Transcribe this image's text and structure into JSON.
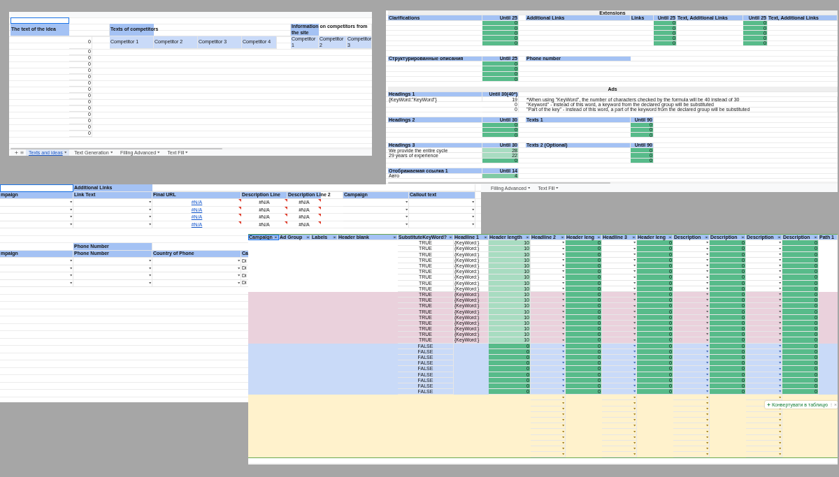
{
  "ideas_sheet": {
    "idea_header": "The text of the idea",
    "competitors_header": "Texts of competitors",
    "competitors": [
      "Competitor 1",
      "Competitor 2",
      "Competitor 3",
      "Competitor 4"
    ],
    "site_header": "Information on competitors from the site",
    "site_competitors": [
      "Competitor 1",
      "Competitor 2",
      "Competitor 3"
    ],
    "counts": [
      "0",
      "0",
      "0",
      "0",
      "0",
      "0",
      "0",
      "0",
      "0",
      "0",
      "0",
      "0",
      "0",
      "0",
      "0"
    ],
    "tabs": [
      {
        "label": "Texts and ideas",
        "selected": true
      },
      {
        "label": "Text Generation",
        "selected": false
      },
      {
        "label": "Filling Advanced",
        "selected": false
      },
      {
        "label": "Text Fill",
        "selected": false
      }
    ]
  },
  "extensions_sheet": {
    "rows": [
      {
        "kind": "band",
        "text": "Extensions"
      },
      {
        "kind": "cells",
        "cells": [
          {
            "text": "Clarifications",
            "kind": "head"
          },
          {
            "text": "Until 25",
            "kind": "head_num"
          },
          null,
          {
            "text": "Additional Links",
            "kind": "head"
          },
          {
            "text": "Links",
            "kind": "head"
          },
          {
            "text": "Until 25",
            "kind": "head_num"
          },
          {
            "text": "Text, Additional Links",
            "kind": "head"
          },
          {
            "text": "Until 25",
            "kind": "head_num"
          },
          {
            "text": "Text, Additional Links",
            "kind": "head"
          }
        ]
      },
      {
        "kind": "cells",
        "cells": [
          null,
          {
            "text": "0",
            "kind": "count"
          },
          null,
          null,
          null,
          {
            "text": "0",
            "kind": "count"
          },
          null,
          {
            "text": "0",
            "kind": "count"
          }
        ]
      },
      {
        "kind": "cells",
        "cells": [
          null,
          {
            "text": "0",
            "kind": "count"
          },
          null,
          null,
          null,
          {
            "text": "0",
            "kind": "count"
          },
          null,
          {
            "text": "0",
            "kind": "count"
          }
        ]
      },
      {
        "kind": "cells",
        "cells": [
          null,
          {
            "text": "0",
            "kind": "count"
          },
          null,
          null,
          null,
          {
            "text": "0",
            "kind": "count"
          },
          null,
          {
            "text": "0",
            "kind": "count"
          }
        ]
      },
      {
        "kind": "cells",
        "cells": [
          null,
          {
            "text": "0",
            "kind": "count"
          },
          null,
          null,
          null,
          {
            "text": "0",
            "kind": "count"
          },
          null,
          {
            "text": "0",
            "kind": "count"
          }
        ]
      },
      {
        "kind": "cells",
        "cells": [
          null,
          {
            "text": "0",
            "kind": "count"
          },
          null,
          null,
          null,
          {
            "text": "0",
            "kind": "count"
          },
          null,
          {
            "text": "0",
            "kind": "count"
          }
        ]
      },
      {
        "kind": "blank"
      },
      {
        "kind": "blank"
      },
      {
        "kind": "cells",
        "cells": [
          {
            "text": "Структурированные описания",
            "kind": "head"
          },
          {
            "text": "Until 25",
            "kind": "head_num"
          },
          null,
          {
            "text": "Phone number",
            "kind": "head"
          }
        ]
      },
      {
        "kind": "cells",
        "cells": [
          null,
          {
            "text": "0",
            "kind": "count"
          }
        ]
      },
      {
        "kind": "cells",
        "cells": [
          null,
          {
            "text": "0",
            "kind": "count"
          }
        ]
      },
      {
        "kind": "cells",
        "cells": [
          null,
          {
            "text": "0",
            "kind": "count"
          }
        ]
      },
      {
        "kind": "cells",
        "cells": [
          null,
          {
            "text": "0",
            "kind": "count"
          }
        ]
      },
      {
        "kind": "blank"
      },
      {
        "kind": "band",
        "text": "Ads"
      },
      {
        "kind": "cells",
        "cells": [
          {
            "text": "Headings 1",
            "kind": "head"
          },
          {
            "text": "Until 30(40*)",
            "kind": "head_num"
          }
        ]
      },
      {
        "kind": "cells",
        "cells": [
          {
            "text": "{KeyWord:\"KeyWord\"}",
            "kind": "text"
          },
          {
            "text": "19",
            "kind": "num"
          },
          null,
          {
            "text": "*When using \"KeyWord\", the number of characters checked by the formula will be 40 instead of 30",
            "kind": "note"
          }
        ]
      },
      {
        "kind": "cells",
        "cells": [
          null,
          {
            "text": "0",
            "kind": "num"
          },
          null,
          {
            "text": "\"Keyword\" - instead of this word, a keyword from the declared group will be substituted",
            "kind": "note"
          }
        ]
      },
      {
        "kind": "cells",
        "cells": [
          null,
          {
            "text": "0",
            "kind": "num"
          },
          null,
          {
            "text": "\"Part of the key\" - instead of this word, a part of the keyword from the declared group will be substituted",
            "kind": "note"
          }
        ]
      },
      {
        "kind": "blank"
      },
      {
        "kind": "cells",
        "cells": [
          {
            "text": "Headings 2",
            "kind": "head"
          },
          {
            "text": "Until 30",
            "kind": "head_num"
          },
          null,
          {
            "text": "Texts 1",
            "kind": "head"
          },
          {
            "text": "Until 90",
            "kind": "head_num"
          }
        ]
      },
      {
        "kind": "cells",
        "cells": [
          null,
          {
            "text": "0",
            "kind": "count"
          },
          null,
          null,
          {
            "text": "0",
            "kind": "count"
          }
        ]
      },
      {
        "kind": "cells",
        "cells": [
          null,
          {
            "text": "0",
            "kind": "count"
          },
          null,
          null,
          {
            "text": "0",
            "kind": "count"
          }
        ]
      },
      {
        "kind": "cells",
        "cells": [
          null,
          {
            "text": "0",
            "kind": "count"
          },
          null,
          null,
          {
            "text": "0",
            "kind": "count"
          }
        ]
      },
      {
        "kind": "blank"
      },
      {
        "kind": "cells",
        "cells": [
          {
            "text": "Headings 3",
            "kind": "head"
          },
          {
            "text": "Until 30",
            "kind": "head_num"
          },
          null,
          {
            "text": "Texts 2 (Optional)",
            "kind": "head"
          },
          {
            "text": "Until 90",
            "kind": "head_num"
          }
        ]
      },
      {
        "kind": "cells",
        "cells": [
          {
            "text": "We provide the entire cycle",
            "kind": "text"
          },
          {
            "text": "28",
            "kind": "count_light"
          },
          null,
          null,
          {
            "text": "0",
            "kind": "count"
          }
        ]
      },
      {
        "kind": "cells",
        "cells": [
          {
            "text": "29 years of experience",
            "kind": "text"
          },
          {
            "text": "22",
            "kind": "count_light"
          },
          null,
          null,
          {
            "text": "0",
            "kind": "count"
          }
        ]
      },
      {
        "kind": "cells",
        "cells": [
          null,
          {
            "text": "0",
            "kind": "count"
          },
          null,
          null,
          {
            "text": "0",
            "kind": "count"
          }
        ]
      },
      {
        "kind": "blank"
      },
      {
        "kind": "cells",
        "cells": [
          {
            "text": "Отображаемая ссылка 1",
            "kind": "head"
          },
          {
            "text": "Until 14",
            "kind": "head_num"
          }
        ]
      },
      {
        "kind": "cells",
        "cells": [
          {
            "text": "Авто",
            "kind": "text"
          },
          {
            "text": "4",
            "kind": "count_soft"
          }
        ]
      }
    ],
    "tabs": [
      {
        "label": "Filling Advanced",
        "selected": false
      },
      {
        "label": "Text Fill",
        "selected": false
      }
    ]
  },
  "links_sheet": {
    "rows": [
      {
        "kind": "cells",
        "cells": [
          {
            "kind": "cursor"
          },
          {
            "text": "Additional Links",
            "kind": "head"
          }
        ]
      },
      {
        "kind": "cells",
        "cells": [
          {
            "text": "mpaign",
            "kind": "head"
          },
          {
            "text": "Link Text",
            "kind": "head"
          },
          {
            "text": "Final URL",
            "kind": "head"
          },
          {
            "text": "Description Line",
            "kind": "head"
          },
          {
            "text": "Description Line 2",
            "kind": "head"
          },
          null,
          {
            "text": "Campaign",
            "kind": "head"
          },
          {
            "text": "Callout text",
            "kind": "head"
          }
        ]
      },
      {
        "kind": "cells",
        "cells": [
          {
            "kind": "dropdown"
          },
          {
            "kind": "dropdown"
          },
          {
            "text": "#N/A",
            "kind": "error_link"
          },
          {
            "text": "#N/A",
            "kind": "error"
          },
          {
            "text": "#N/A",
            "kind": "error"
          },
          null,
          {
            "kind": "dropdown"
          },
          {
            "kind": "dropdown"
          }
        ]
      },
      {
        "kind": "cells",
        "cells": [
          {
            "kind": "dropdown"
          },
          {
            "kind": "dropdown"
          },
          {
            "text": "#N/A",
            "kind": "error_link"
          },
          {
            "text": "#N/A",
            "kind": "error"
          },
          {
            "text": "#N/A",
            "kind": "error"
          },
          null,
          {
            "kind": "dropdown"
          },
          {
            "kind": "dropdown"
          }
        ]
      },
      {
        "kind": "cells",
        "cells": [
          {
            "kind": "dropdown"
          },
          {
            "kind": "dropdown"
          },
          {
            "text": "#N/A",
            "kind": "error_link"
          },
          {
            "text": "#N/A",
            "kind": "error"
          },
          {
            "text": "#N/A",
            "kind": "error"
          },
          null,
          {
            "kind": "dropdown"
          },
          {
            "kind": "dropdown"
          }
        ]
      },
      {
        "kind": "cells",
        "cells": [
          {
            "kind": "dropdown"
          },
          {
            "kind": "dropdown"
          },
          {
            "text": "#N/A",
            "kind": "error_link"
          },
          {
            "text": "#N/A",
            "kind": "error"
          },
          {
            "text": "#N/A",
            "kind": "error"
          },
          null,
          {
            "kind": "dropdown"
          },
          {
            "kind": "dropdown"
          }
        ]
      },
      {
        "kind": "blank"
      },
      {
        "kind": "blank"
      },
      {
        "kind": "cells",
        "cells": [
          null,
          {
            "text": "Phone Number",
            "kind": "head"
          }
        ]
      },
      {
        "kind": "cells",
        "cells": [
          {
            "text": "mpaign",
            "kind": "head"
          },
          {
            "text": "Phone Number",
            "kind": "head"
          },
          {
            "text": "Country of Phone",
            "kind": "head"
          },
          {
            "text": "Ca",
            "kind": "head"
          }
        ]
      },
      {
        "kind": "cells",
        "cells": [
          {
            "kind": "dropdown"
          },
          {
            "kind": "dropdown"
          },
          {
            "kind": "dropdown"
          },
          {
            "text": "Di",
            "kind": "text"
          }
        ]
      },
      {
        "kind": "cells",
        "cells": [
          {
            "kind": "dropdown"
          },
          {
            "kind": "dropdown"
          },
          {
            "kind": "dropdown"
          },
          {
            "text": "Di",
            "kind": "text"
          }
        ]
      },
      {
        "kind": "cells",
        "cells": [
          {
            "kind": "dropdown"
          },
          {
            "kind": "dropdown"
          },
          {
            "kind": "dropdown"
          },
          {
            "text": "Di",
            "kind": "text"
          }
        ]
      },
      {
        "kind": "cells",
        "cells": [
          {
            "kind": "dropdown"
          },
          {
            "kind": "dropdown"
          },
          {
            "kind": "dropdown"
          },
          {
            "text": "Di",
            "kind": "text"
          }
        ]
      }
    ]
  },
  "ads_table": {
    "columns": [
      {
        "label": "Campaign",
        "filter": true
      },
      {
        "label": "Ad Group",
        "filter": true
      },
      {
        "label": "Labels",
        "filter": true
      },
      {
        "label": "Header blank",
        "filter": true
      },
      {
        "label": "SubstituteKeyWord?",
        "filter": true
      },
      {
        "label": "Headline 1",
        "filter": true
      },
      {
        "label": "Header length",
        "filter": true
      },
      {
        "label": "Headline 2",
        "filter": true
      },
      {
        "label": "Header leng",
        "filter": true
      },
      {
        "label": "Headline 3",
        "filter": true
      },
      {
        "label": "Header leng",
        "filter": true
      },
      {
        "label": "Description",
        "filter": true
      },
      {
        "label": "Description",
        "filter": true
      },
      {
        "label": "Description",
        "filter": true
      },
      {
        "label": "Description",
        "filter": true
      },
      {
        "label": "Path 1",
        "filter": false
      }
    ],
    "rows": [
      {
        "color": "#ffffff",
        "kind": "keyword",
        "substitute": "TRUE",
        "headline_1": "{KeyWord:}",
        "header_length": "10",
        "lengths": [
          "0",
          "0",
          "0",
          "0"
        ]
      },
      {
        "color": "#ffffff",
        "kind": "keyword",
        "substitute": "TRUE",
        "headline_1": "{KeyWord:}",
        "header_length": "10",
        "lengths": [
          "0",
          "0",
          "0",
          "0"
        ]
      },
      {
        "color": "#ffffff",
        "kind": "keyword",
        "substitute": "TRUE",
        "headline_1": "{KeyWord:}",
        "header_length": "10",
        "lengths": [
          "0",
          "0",
          "0",
          "0"
        ]
      },
      {
        "color": "#ffffff",
        "kind": "keyword",
        "substitute": "TRUE",
        "headline_1": "{KeyWord:}",
        "header_length": "10",
        "lengths": [
          "0",
          "0",
          "0",
          "0"
        ]
      },
      {
        "color": "#ffffff",
        "kind": "keyword",
        "substitute": "TRUE",
        "headline_1": "{KeyWord:}",
        "header_length": "10",
        "lengths": [
          "0",
          "0",
          "0",
          "0"
        ]
      },
      {
        "color": "#ffffff",
        "kind": "keyword",
        "substitute": "TRUE",
        "headline_1": "{KeyWord:}",
        "header_length": "10",
        "lengths": [
          "0",
          "0",
          "0",
          "0"
        ]
      },
      {
        "color": "#ffffff",
        "kind": "keyword",
        "substitute": "TRUE",
        "headline_1": "{KeyWord:}",
        "header_length": "10",
        "lengths": [
          "0",
          "0",
          "0",
          "0"
        ]
      },
      {
        "color": "#ffffff",
        "kind": "keyword",
        "substitute": "TRUE",
        "headline_1": "{KeyWord:}",
        "header_length": "10",
        "lengths": [
          "0",
          "0",
          "0",
          "0"
        ]
      },
      {
        "color": "#ffffff",
        "kind": "keyword",
        "substitute": "TRUE",
        "headline_1": "{KeyWord:}",
        "header_length": "10",
        "lengths": [
          "0",
          "0",
          "0",
          "0"
        ]
      },
      {
        "color": "#ead1dc",
        "kind": "keyword",
        "substitute": "TRUE",
        "headline_1": "{KeyWord:}",
        "header_length": "10",
        "lengths": [
          "0",
          "0",
          "0",
          "0"
        ]
      },
      {
        "color": "#ead1dc",
        "kind": "keyword",
        "substitute": "TRUE",
        "headline_1": "{KeyWord:}",
        "header_length": "10",
        "lengths": [
          "0",
          "0",
          "0",
          "0"
        ]
      },
      {
        "color": "#ead1dc",
        "kind": "keyword",
        "substitute": "TRUE",
        "headline_1": "{KeyWord:}",
        "header_length": "10",
        "lengths": [
          "0",
          "0",
          "0",
          "0"
        ]
      },
      {
        "color": "#ead1dc",
        "kind": "keyword",
        "substitute": "TRUE",
        "headline_1": "{KeyWord:}",
        "header_length": "10",
        "lengths": [
          "0",
          "0",
          "0",
          "0"
        ]
      },
      {
        "color": "#ead1dc",
        "kind": "keyword",
        "substitute": "TRUE",
        "headline_1": "{KeyWord:}",
        "header_length": "10",
        "lengths": [
          "0",
          "0",
          "0",
          "0"
        ]
      },
      {
        "color": "#ead1dc",
        "kind": "keyword",
        "substitute": "TRUE",
        "headline_1": "{KeyWord:}",
        "header_length": "10",
        "lengths": [
          "0",
          "0",
          "0",
          "0"
        ]
      },
      {
        "color": "#ead1dc",
        "kind": "keyword",
        "substitute": "TRUE",
        "headline_1": "{KeyWord:}",
        "header_length": "10",
        "lengths": [
          "0",
          "0",
          "0",
          "0"
        ]
      },
      {
        "color": "#ead1dc",
        "kind": "keyword",
        "substitute": "TRUE",
        "headline_1": "{KeyWord:}",
        "header_length": "10",
        "lengths": [
          "0",
          "0",
          "0",
          "0"
        ]
      },
      {
        "color": "#ead1dc",
        "kind": "keyword",
        "substitute": "TRUE",
        "headline_1": "{KeyWord:}",
        "header_length": "10",
        "lengths": [
          "0",
          "0",
          "0",
          "0"
        ]
      },
      {
        "color": "#c9daf8",
        "kind": "plain",
        "substitute": "FALSE",
        "header_length": "0",
        "lengths": [
          "0",
          "0",
          "0",
          "0"
        ]
      },
      {
        "color": "#c9daf8",
        "kind": "plain",
        "substitute": "FALSE",
        "header_length": "0",
        "lengths": [
          "0",
          "0",
          "0",
          "0"
        ]
      },
      {
        "color": "#c9daf8",
        "kind": "plain",
        "substitute": "FALSE",
        "header_length": "0",
        "lengths": [
          "0",
          "0",
          "0",
          "0"
        ]
      },
      {
        "color": "#c9daf8",
        "kind": "plain",
        "substitute": "FALSE",
        "header_length": "0",
        "lengths": [
          "0",
          "0",
          "0",
          "0"
        ]
      },
      {
        "color": "#c9daf8",
        "kind": "plain",
        "substitute": "FALSE",
        "header_length": "0",
        "lengths": [
          "0",
          "0",
          "0",
          "0"
        ]
      },
      {
        "color": "#c9daf8",
        "kind": "plain",
        "substitute": "FALSE",
        "header_length": "0",
        "lengths": [
          "0",
          "0",
          "0",
          "0"
        ]
      },
      {
        "color": "#c9daf8",
        "kind": "plain",
        "substitute": "FALSE",
        "header_length": "0",
        "lengths": [
          "0",
          "0",
          "0",
          "0"
        ]
      },
      {
        "color": "#c9daf8",
        "kind": "plain",
        "substitute": "FALSE",
        "header_length": "0",
        "lengths": [
          "0",
          "0",
          "0",
          "0"
        ]
      },
      {
        "color": "#c9daf8",
        "kind": "plain",
        "substitute": "FALSE",
        "header_length": "0",
        "lengths": [
          "0",
          "0",
          "0",
          "0"
        ]
      },
      {
        "color": "#fff2cc",
        "kind": "empty"
      },
      {
        "color": "#fff2cc",
        "kind": "empty"
      },
      {
        "color": "#fff2cc",
        "kind": "empty"
      },
      {
        "color": "#fff2cc",
        "kind": "empty"
      },
      {
        "color": "#fff2cc",
        "kind": "empty"
      },
      {
        "color": "#fff2cc",
        "kind": "empty"
      },
      {
        "color": "#fff2cc",
        "kind": "empty"
      },
      {
        "color": "#fff2cc",
        "kind": "empty"
      },
      {
        "color": "#fff2cc",
        "kind": "empty"
      },
      {
        "color": "#fff2cc",
        "kind": "empty"
      },
      {
        "color": "#fff2cc",
        "kind": "empty"
      }
    ],
    "popup": {
      "label": "Конвертувати в таблицю"
    }
  }
}
